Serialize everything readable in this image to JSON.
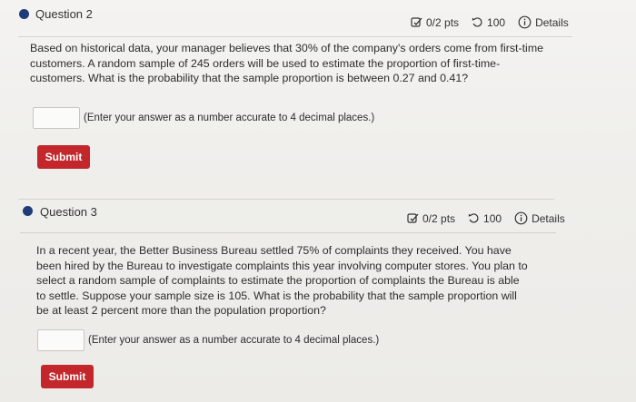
{
  "questions": [
    {
      "title": "Question 2",
      "points": "0/2 pts",
      "attempts": "100",
      "details_label": "Details",
      "text": "Based on historical data, your manager believes that 30% of the company's orders come from first-time customers. A random sample of 245 orders will be used to estimate the proportion of first-time-customers. What is the probability that the sample proportion is between 0.27 and 0.41?",
      "answer_value": "",
      "hint": "(Enter your answer as a number accurate to 4 decimal places.)",
      "submit_label": "Submit"
    },
    {
      "title": "Question 3",
      "points": "0/2 pts",
      "attempts": "100",
      "details_label": "Details",
      "text": "In a recent year, the Better Business Bureau settled 75% of complaints they received. You have been hired by the Bureau to investigate complaints this year involving computer stores. You plan to select a random sample of complaints to estimate the proportion of complaints the Bureau is able to settle. Suppose your sample size is 105. What is the probability that the sample proportion will be at least 2 percent more than the population proportion?",
      "answer_value": "",
      "hint": "(Enter your answer as a number accurate to 4 decimal places.)",
      "submit_label": "Submit"
    }
  ],
  "icons": {
    "points": "checkbox-pencil-icon",
    "attempts": "retry-icon",
    "details": "info-icon"
  },
  "colors": {
    "accent_dot": "#1f3c78",
    "submit_bg": "#c3272b",
    "background": "#efedea"
  }
}
